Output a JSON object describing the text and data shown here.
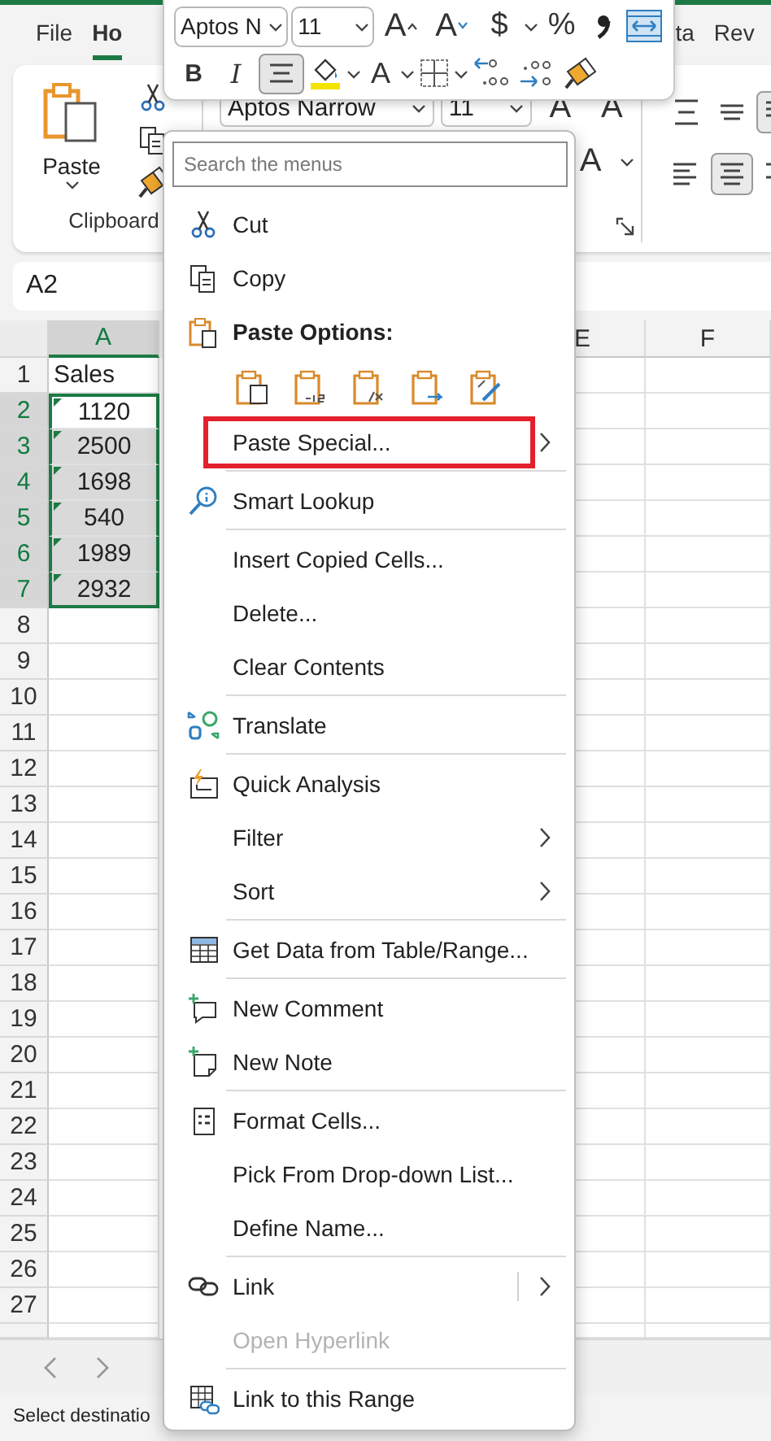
{
  "tabs": [
    {
      "label": "File",
      "selected": false
    },
    {
      "label": "Ho",
      "selected": true
    },
    {
      "label": "ta",
      "selected": false
    },
    {
      "label": "Rev",
      "selected": false
    }
  ],
  "ribbon": {
    "paste_label": "Paste",
    "group_label": "Clipboard",
    "font_name": "Aptos Narrow",
    "font_size": "11",
    "grow_label": "A",
    "shrink_label": "A",
    "font_color_label": "A",
    "align_buttons": [
      {
        "selected": false
      },
      {
        "selected": false
      },
      {
        "selected": true
      },
      {
        "selected": false
      },
      {
        "selected": true
      },
      {
        "selected": false
      }
    ]
  },
  "name_box": "A2",
  "sheet": {
    "columns": [
      {
        "label": "A",
        "selected": true
      },
      {
        "label": "E",
        "selected": false
      },
      {
        "label": "F",
        "selected": false
      }
    ],
    "rows": [
      {
        "label": "1",
        "selected": false,
        "cell": {
          "kind": "label",
          "value": "Sales",
          "selected": false,
          "active": false,
          "flag": false
        }
      },
      {
        "label": "2",
        "selected": true,
        "cell": {
          "kind": "number",
          "value": "1120",
          "selected": true,
          "active": true,
          "flag": true
        }
      },
      {
        "label": "3",
        "selected": true,
        "cell": {
          "kind": "number",
          "value": "2500",
          "selected": true,
          "active": false,
          "flag": true
        }
      },
      {
        "label": "4",
        "selected": true,
        "cell": {
          "kind": "number",
          "value": "1698",
          "selected": true,
          "active": false,
          "flag": true
        }
      },
      {
        "label": "5",
        "selected": true,
        "cell": {
          "kind": "number",
          "value": "540",
          "selected": true,
          "active": false,
          "flag": true
        }
      },
      {
        "label": "6",
        "selected": true,
        "cell": {
          "kind": "number",
          "value": "1989",
          "selected": true,
          "active": false,
          "flag": true
        }
      },
      {
        "label": "7",
        "selected": true,
        "cell": {
          "kind": "number",
          "value": "2932",
          "selected": true,
          "active": false,
          "flag": true
        }
      },
      {
        "label": "8",
        "selected": false
      },
      {
        "label": "9",
        "selected": false
      },
      {
        "label": "10",
        "selected": false
      },
      {
        "label": "11",
        "selected": false
      },
      {
        "label": "12",
        "selected": false
      },
      {
        "label": "13",
        "selected": false
      },
      {
        "label": "14",
        "selected": false
      },
      {
        "label": "15",
        "selected": false
      },
      {
        "label": "16",
        "selected": false
      },
      {
        "label": "17",
        "selected": false
      },
      {
        "label": "18",
        "selected": false
      },
      {
        "label": "19",
        "selected": false
      },
      {
        "label": "20",
        "selected": false
      },
      {
        "label": "21",
        "selected": false
      },
      {
        "label": "22",
        "selected": false
      },
      {
        "label": "23",
        "selected": false
      },
      {
        "label": "24",
        "selected": false
      },
      {
        "label": "25",
        "selected": false
      },
      {
        "label": "26",
        "selected": false
      },
      {
        "label": "27",
        "selected": false
      }
    ]
  },
  "status_bar": {
    "text": "Select destinatio"
  },
  "mini_toolbar": {
    "font_controls": [
      {
        "kind": "font",
        "value": "Aptos N"
      },
      {
        "kind": "size",
        "value": "11"
      },
      {
        "kind": "grow",
        "label": "A"
      },
      {
        "kind": "shrink",
        "label": "A"
      },
      {
        "kind": "symbol",
        "label": "$"
      },
      {
        "kind": "caret"
      },
      {
        "kind": "symbol",
        "label": "%"
      },
      {
        "kind": "comma"
      },
      {
        "kind": "wrap"
      }
    ],
    "format_controls": [
      {
        "kind": "bold",
        "label": "B"
      },
      {
        "kind": "italic",
        "label": "I"
      },
      {
        "kind": "align",
        "selected": true
      },
      {
        "kind": "fill"
      },
      {
        "kind": "caret"
      },
      {
        "kind": "color",
        "label": "A"
      },
      {
        "kind": "caret"
      },
      {
        "kind": "borders"
      },
      {
        "kind": "caret"
      },
      {
        "kind": "inc_decimal"
      },
      {
        "kind": "dec_decimal"
      },
      {
        "kind": "painter"
      }
    ]
  },
  "context_menu": {
    "search_placeholder": "Search the menus",
    "sections": [
      [
        {
          "kind": "item",
          "label": "Cut",
          "submenu": false,
          "disabled": false,
          "outlined": false
        },
        {
          "kind": "item",
          "label": "Copy",
          "submenu": false,
          "disabled": false,
          "outlined": false
        },
        {
          "kind": "header",
          "label": "Paste Options:"
        },
        {
          "kind": "paste_icons"
        },
        {
          "kind": "item",
          "label": "Paste Special...",
          "submenu": true,
          "disabled": false,
          "outlined": true
        }
      ],
      [
        {
          "kind": "item",
          "label": "Smart Lookup",
          "submenu": false,
          "disabled": false,
          "outlined": false
        }
      ],
      [
        {
          "kind": "item",
          "label": "Insert Copied Cells...",
          "submenu": false,
          "disabled": false,
          "outlined": false
        },
        {
          "kind": "item",
          "label": "Delete...",
          "submenu": false,
          "disabled": false,
          "outlined": false
        },
        {
          "kind": "item",
          "label": "Clear Contents",
          "submenu": false,
          "disabled": false,
          "outlined": false
        }
      ],
      [
        {
          "kind": "item",
          "label": "Translate",
          "submenu": false,
          "disabled": false,
          "outlined": false
        }
      ],
      [
        {
          "kind": "item",
          "label": "Quick Analysis",
          "submenu": false,
          "disabled": false,
          "outlined": false
        },
        {
          "kind": "item",
          "label": "Filter",
          "submenu": true,
          "disabled": false,
          "outlined": false
        },
        {
          "kind": "item",
          "label": "Sort",
          "submenu": true,
          "disabled": false,
          "outlined": false
        }
      ],
      [
        {
          "kind": "item",
          "label": "Get Data from Table/Range...",
          "submenu": false,
          "disabled": false,
          "outlined": false
        }
      ],
      [
        {
          "kind": "item",
          "label": "New Comment",
          "submenu": false,
          "disabled": false,
          "outlined": false
        },
        {
          "kind": "item",
          "label": "New Note",
          "submenu": false,
          "disabled": false,
          "outlined": false
        }
      ],
      [
        {
          "kind": "item",
          "label": "Format Cells...",
          "submenu": false,
          "disabled": false,
          "outlined": false
        },
        {
          "kind": "item",
          "label": "Pick From Drop-down List...",
          "submenu": false,
          "disabled": false,
          "outlined": false
        },
        {
          "kind": "item",
          "label": "Define Name...",
          "submenu": false,
          "disabled": false,
          "outlined": false
        }
      ],
      [
        {
          "kind": "item",
          "label": "Link",
          "submenu": true,
          "disabled": false,
          "outlined": false
        },
        {
          "kind": "item",
          "label": "Open Hyperlink",
          "submenu": false,
          "disabled": true,
          "outlined": false
        }
      ],
      [
        {
          "kind": "item",
          "label": "Link to this Range",
          "submenu": false,
          "disabled": false,
          "outlined": false
        }
      ]
    ]
  }
}
